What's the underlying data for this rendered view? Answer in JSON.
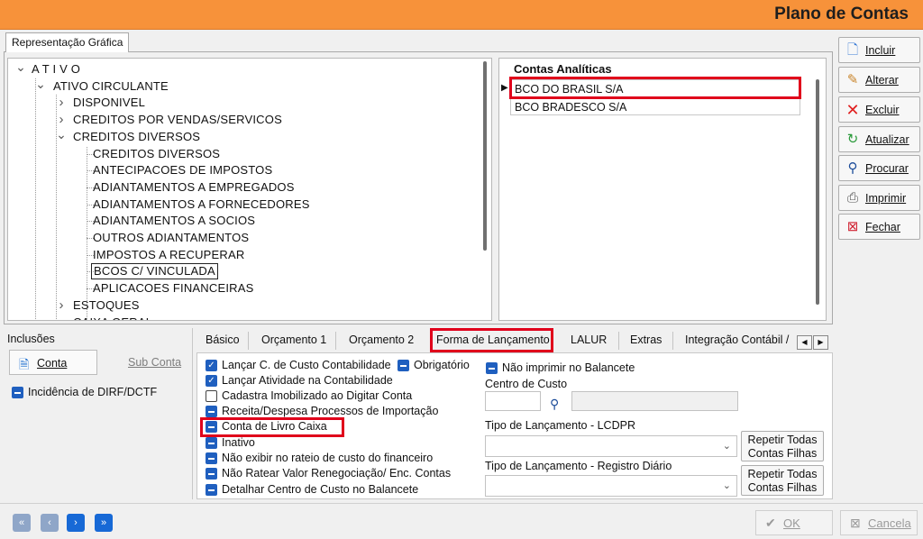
{
  "window": {
    "title": "Plano de Contas"
  },
  "top_tab": {
    "label": "Representação Gráfica"
  },
  "tree": [
    {
      "label": "A T I V O",
      "toggle": "v"
    },
    {
      "label": "ATIVO CIRCULANTE",
      "toggle": "v"
    },
    {
      "label": "DISPONIVEL",
      "toggle": ">"
    },
    {
      "label": "CREDITOS POR VENDAS/SERVICOS",
      "toggle": ">"
    },
    {
      "label": "CREDITOS DIVERSOS",
      "toggle": "v"
    },
    {
      "label": "CREDITOS DIVERSOS",
      "toggle": ""
    },
    {
      "label": "ANTECIPACOES DE IMPOSTOS",
      "toggle": ""
    },
    {
      "label": "ADIANTAMENTOS A EMPREGADOS",
      "toggle": ""
    },
    {
      "label": "ADIANTAMENTOS A FORNECEDORES",
      "toggle": ""
    },
    {
      "label": "ADIANTAMENTOS A SOCIOS",
      "toggle": ""
    },
    {
      "label": "OUTROS ADIANTAMENTOS",
      "toggle": ""
    },
    {
      "label": "IMPOSTOS A RECUPERAR",
      "toggle": ""
    },
    {
      "label": "BCOS C/ VINCULADA",
      "toggle": ""
    },
    {
      "label": "APLICACOES FINANCEIRAS",
      "toggle": ""
    },
    {
      "label": "ESTOQUES",
      "toggle": ">"
    },
    {
      "label": "CAIXA GERAL",
      "toggle": ""
    }
  ],
  "grid": {
    "header": "Contas Analíticas",
    "rows": [
      "BCO DO BRASIL S/A",
      "BCO BRADESCO S/A"
    ]
  },
  "right_buttons": {
    "incluir": "Incluir",
    "alterar": "Alterar",
    "excluir": "Excluir",
    "atualizar": "Atualizar",
    "procurar": "Procurar",
    "imprimir": "Imprimir",
    "fechar": "Fechar"
  },
  "inclusoes": {
    "title": "Inclusões",
    "conta": "Conta",
    "sub_conta": "Sub Conta",
    "dirf": "Incidência de DIRF/DCTF"
  },
  "tabs": [
    "Básico",
    "Orçamento 1",
    "Orçamento 2",
    "Forma de Lançamento",
    "LALUR",
    "Extras",
    "Integração Contábil /"
  ],
  "options": {
    "custo": "Lançar C. de Custo Contabilidade",
    "obrigatorio": "Obrigatório",
    "atividade": "Lançar Atividade na Contabilidade",
    "imobilizado": "Cadastra Imobilizado ao Digitar Conta",
    "receita": "Receita/Despesa Processos de Importação",
    "livro_caixa": "Conta de  Livro Caixa",
    "inativo": "Inativo",
    "nao_rateio": "Não exibir no rateio de custo do financeiro",
    "nao_ratear": "Não Ratear Valor Renegociação/ Enc. Contas",
    "detalhar": "Detalhar Centro de Custo no Balancete",
    "nao_imprimir": "Não imprimir no Balancete"
  },
  "fields": {
    "centro_custo": "Centro de Custo",
    "tipo_lcdpr": "Tipo de Lançamento - LCDPR",
    "tipo_diario": "Tipo de Lançamento - Registro Diário",
    "repetir_line1": "Repetir Todas",
    "repetir_line2": "Contas Filhas"
  },
  "bottom": {
    "ok": "OK",
    "cancela": "Cancela"
  },
  "colors": {
    "title_bar": "#f7923a",
    "highlight": "#e0001b",
    "checkbox": "#1f5fbf"
  }
}
